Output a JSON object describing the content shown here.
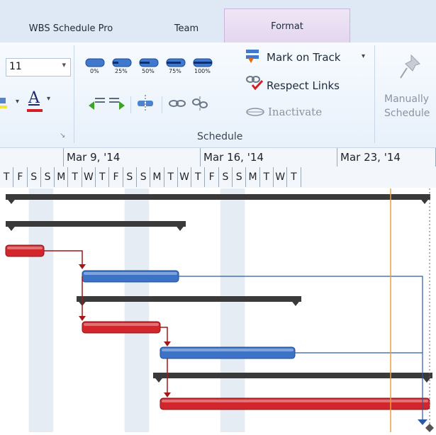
{
  "tabs": [
    {
      "label": "WBS Schedule Pro"
    },
    {
      "label": "Team"
    },
    {
      "label": "Format"
    }
  ],
  "ribbon": {
    "font_size": "11",
    "font_color_letter": "A",
    "percent_labels": [
      "0%",
      "25%",
      "50%",
      "75%",
      "100%"
    ],
    "mark_on_track": "Mark on Track",
    "respect_links": "Respect Links",
    "inactivate": "Inactivate",
    "manually_schedule_line1": "Manually",
    "manually_schedule_line2": "Schedule",
    "group_label": "Schedule"
  },
  "timescale": {
    "weeks": [
      "Mar 9, '14",
      "Mar 16, '14",
      "Mar 23, '14"
    ],
    "days": [
      "T",
      "F",
      "S",
      "S",
      "M",
      "T",
      "W",
      "T",
      "F",
      "S",
      "S",
      "M",
      "T",
      "W",
      "T",
      "F",
      "S",
      "S",
      "M",
      "T",
      "W",
      "T"
    ]
  },
  "chart_data": {
    "type": "gantt",
    "bars": [
      {
        "kind": "summary",
        "color": "#3a3a3a"
      },
      {
        "kind": "summary",
        "color": "#3a3a3a"
      },
      {
        "kind": "critical-task",
        "color": "#d1262b"
      },
      {
        "kind": "task",
        "color": "#3d73c7"
      },
      {
        "kind": "summary",
        "color": "#3a3a3a"
      },
      {
        "kind": "critical-task",
        "color": "#d1262b"
      },
      {
        "kind": "task",
        "color": "#3d73c7"
      },
      {
        "kind": "summary",
        "color": "#3a3a3a"
      },
      {
        "kind": "critical-task",
        "color": "#d1262b"
      }
    ],
    "colors": {
      "status_date_line": "#e8a040",
      "critical_link": "#a01818",
      "normal_link": "#2a5aa8"
    }
  }
}
